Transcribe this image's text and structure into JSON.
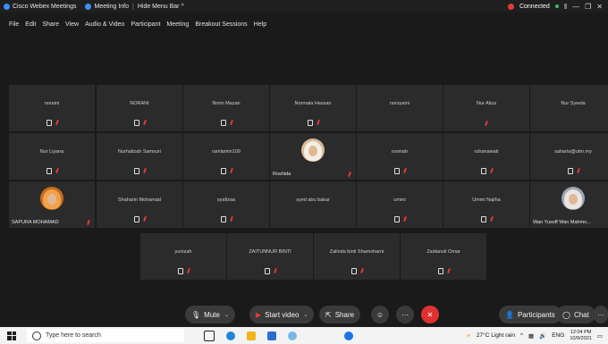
{
  "titlebar": {
    "app_title": "Cisco Webex Meetings",
    "meeting_info": "Meeting Info",
    "hide_menu_bar": "Hide Menu Bar ^",
    "status": "Connected",
    "status_color": "#e53935",
    "minimize": "—",
    "restore": "❐",
    "close": "✕"
  },
  "menu": [
    "File",
    "Edit",
    "Share",
    "View",
    "Audio & Video",
    "Participant",
    "Meeting",
    "Breakout Sessions",
    "Help"
  ],
  "tiles": [
    {
      "name": "noraini",
      "avatar": "none",
      "mic": true,
      "mute": true
    },
    {
      "name": "NORANI",
      "avatar": "none",
      "mic": true,
      "mute": true
    },
    {
      "name": "Norin Mazan",
      "avatar": "none",
      "mic": true,
      "mute": true
    },
    {
      "name": "Normala Hassan",
      "avatar": "none",
      "mic": true,
      "mute": true
    },
    {
      "name": "norsyaini",
      "avatar": "none",
      "mic": false,
      "mute": false
    },
    {
      "name": "Nur Aliza",
      "avatar": "none",
      "mic": false,
      "mute": true
    },
    {
      "name": "Nur Syeela",
      "avatar": "none",
      "mic": false,
      "mute": false
    },
    {
      "name": "Nur Liyana",
      "avatar": "none",
      "mic": true,
      "mute": true
    },
    {
      "name": "Nurhalizah Samsuri",
      "avatar": "none",
      "mic": true,
      "mute": true
    },
    {
      "name": "ramlamin109",
      "avatar": "none",
      "mic": true,
      "mute": true
    },
    {
      "name": "Roshida",
      "avatar": "photo",
      "mic": false,
      "mute": true
    },
    {
      "name": "rosmah",
      "avatar": "none",
      "mic": true,
      "mute": true
    },
    {
      "name": "ruhanawati",
      "avatar": "none",
      "mic": true,
      "mute": true
    },
    {
      "name": "saharia@utm.my",
      "avatar": "none",
      "mic": true,
      "mute": true
    },
    {
      "name": "SAPURA MOHAMAD",
      "avatar": "orange",
      "mic": false,
      "mute": true
    },
    {
      "name": "Shaharin Mohamad",
      "avatar": "none",
      "mic": true,
      "mute": true
    },
    {
      "name": "syafizaa",
      "avatar": "none",
      "mic": true,
      "mute": true
    },
    {
      "name": "syed abu bakar",
      "avatar": "none",
      "mic": false,
      "mute": false
    },
    {
      "name": "ummi",
      "avatar": "none",
      "mic": true,
      "mute": true
    },
    {
      "name": "Ummi Najiha",
      "avatar": "none",
      "mic": true,
      "mute": true
    },
    {
      "name": "Wan Yusoff Wan Mahmo...",
      "avatar": "grey",
      "mic": false,
      "mute": true
    },
    {
      "name": "yunizah",
      "avatar": "none",
      "mic": true,
      "mute": true
    },
    {
      "name": "ZAITUNNUR BINTI",
      "avatar": "none",
      "mic": true,
      "mute": true
    },
    {
      "name": "Zalinda binti Shamsharni",
      "avatar": "none",
      "mic": true,
      "mute": true
    },
    {
      "name": "Zaidanuli Omar",
      "avatar": "none",
      "mic": true,
      "mute": true
    }
  ],
  "controls": {
    "mute": "Mute",
    "start_video": "Start video",
    "share": "Share",
    "participants": "Participants",
    "chat": "Chat",
    "more": "···"
  },
  "taskbar": {
    "search_placeholder": "Type here to search",
    "weather": "27°C  Light rain",
    "lang": "ENG",
    "time": "12:04 PM",
    "date": "10/9/2021"
  }
}
